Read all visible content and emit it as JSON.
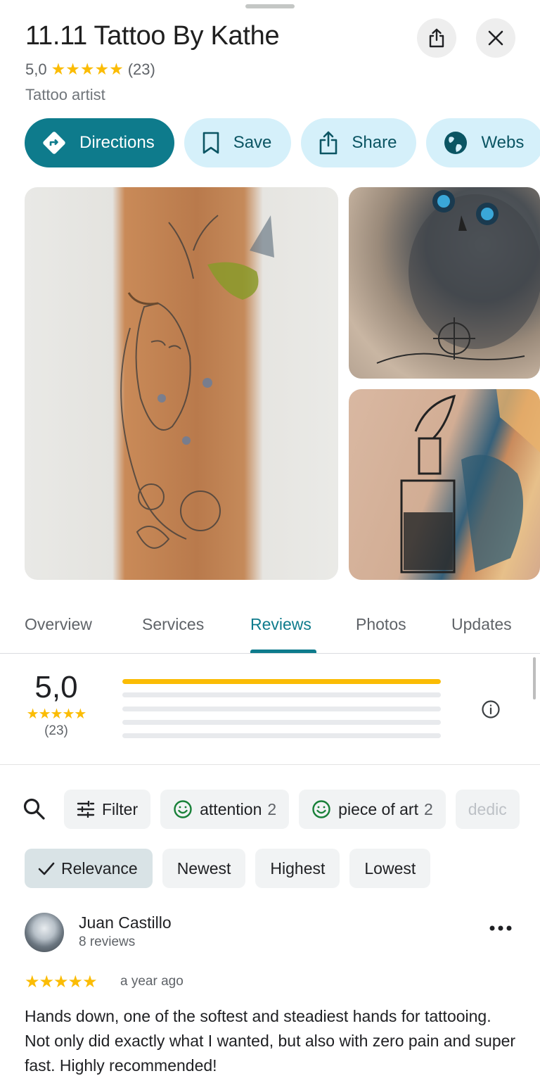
{
  "place": {
    "title": "11.11 Tattoo By Kathe",
    "rating": "5,0",
    "stars": "★★★★★",
    "review_count": "(23)",
    "category": "Tattoo artist"
  },
  "header_buttons": {
    "share_icon": "share-icon",
    "close_icon": "close-icon"
  },
  "actions": [
    {
      "label": "Directions",
      "icon": "directions-icon"
    },
    {
      "label": "Save",
      "icon": "bookmark-icon"
    },
    {
      "label": "Share",
      "icon": "share-icon"
    },
    {
      "label": "Webs",
      "icon": "globe-icon"
    }
  ],
  "photos": [
    "tattoo-sleeve-photo",
    "owl-tattoo-photo",
    "bottle-tattoo-photo"
  ],
  "tabs": [
    {
      "label": "Overview"
    },
    {
      "label": "Services"
    },
    {
      "label": "Reviews",
      "active": true
    },
    {
      "label": "Photos"
    },
    {
      "label": "Updates"
    }
  ],
  "summary": {
    "average": "5,0",
    "stars": "★★★★★",
    "count": "(23)",
    "distribution": [
      1.0,
      0,
      0,
      0,
      0
    ]
  },
  "filters": [
    {
      "label": "Filter",
      "icon": "tune-icon"
    },
    {
      "label": "attention",
      "count": "2",
      "icon": "smiley-icon"
    },
    {
      "label": "piece of art",
      "count": "2",
      "icon": "smiley-icon"
    },
    {
      "label": "dedic",
      "icon": ""
    }
  ],
  "sort": [
    {
      "label": "Relevance",
      "active": true
    },
    {
      "label": "Newest"
    },
    {
      "label": "Highest"
    },
    {
      "label": "Lowest"
    }
  ],
  "review": {
    "author": "Juan Castillo",
    "author_reviews": "8 reviews",
    "stars": "★★★★★",
    "date": "a year ago",
    "text": "Hands down, one of the softest and steadiest hands for tattooing. Not only did exactly what I wanted, but also with zero pain and super fast. Highly recommended!"
  },
  "colors": {
    "accent": "#0e7b8c",
    "chip_bg": "#d5f0fa",
    "star": "#fbbc04"
  }
}
